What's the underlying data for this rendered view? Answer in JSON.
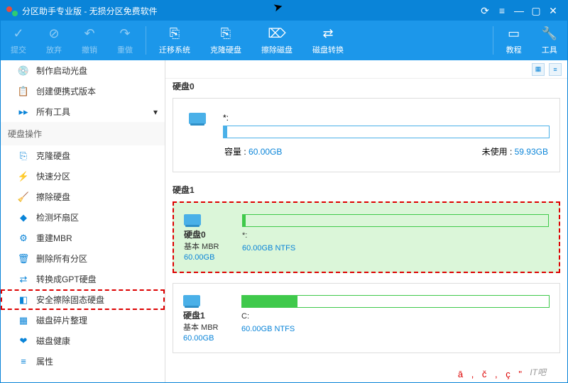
{
  "window": {
    "title": "分区助手专业版 - 无损分区免费软件"
  },
  "toolbar": {
    "commit": "提交",
    "discard": "放弃",
    "undo": "撤销",
    "redo": "重做",
    "migrate": "迁移系统",
    "clone": "克隆硬盘",
    "wipe": "擦除磁盘",
    "convert": "磁盘转换",
    "tutorial": "教程",
    "tools": "工具"
  },
  "sidebar": {
    "top": [
      {
        "icon": "💿",
        "label": "制作启动光盘"
      },
      {
        "icon": "📋",
        "label": "创建便携式版本"
      },
      {
        "icon": "▸▸",
        "label": "所有工具",
        "arrow": true
      }
    ],
    "header": "硬盘操作",
    "ops": [
      {
        "icon": "⎘",
        "label": "克隆硬盘"
      },
      {
        "icon": "⚡",
        "label": "快速分区"
      },
      {
        "icon": "🧹",
        "label": "擦除硬盘"
      },
      {
        "icon": "◆",
        "label": "检测坏扇区"
      },
      {
        "icon": "⚙",
        "label": "重建MBR"
      },
      {
        "icon": "🗑",
        "label": "删除所有分区"
      },
      {
        "icon": "⇄",
        "label": "转换成GPT硬盘"
      },
      {
        "icon": "◧",
        "label": "安全擦除固态硬盘",
        "hl": true
      },
      {
        "icon": "▦",
        "label": "磁盘碎片整理"
      },
      {
        "icon": "❤",
        "label": "磁盘健康"
      },
      {
        "icon": "≡",
        "label": "属性"
      }
    ]
  },
  "content": {
    "disk0": {
      "title": "硬盘0",
      "partLabel": "*:",
      "capLabel": "容量 :",
      "capVal": "60.00GB",
      "freeLabel": "未使用 :",
      "freeVal": "59.93GB"
    },
    "disk1": {
      "title": "硬盘1"
    },
    "card0": {
      "name": "硬盘0",
      "type": "基本 MBR",
      "size": "60.00GB",
      "pLabel": "*:",
      "pInfo": "60.00GB NTFS"
    },
    "card1": {
      "name": "硬盘1",
      "type": "基本 MBR",
      "size": "60.00GB",
      "pLabel": "C:",
      "pInfo": "60.00GB NTFS"
    }
  },
  "ime": "ā , č , ç \"",
  "watermark": "IT吧"
}
